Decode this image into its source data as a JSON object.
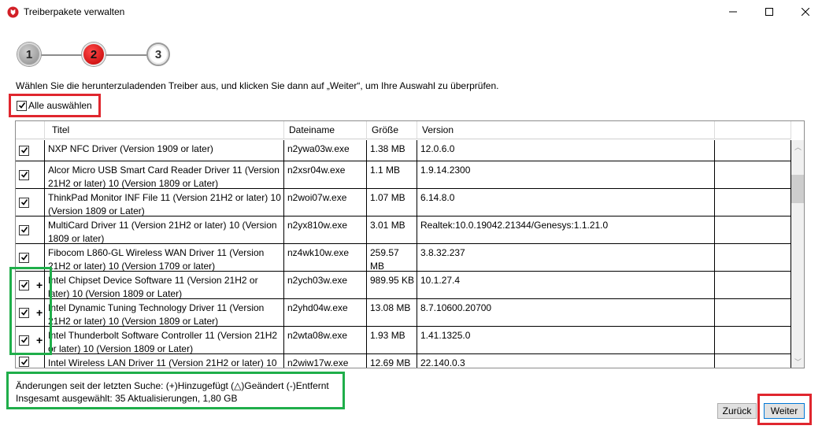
{
  "window": {
    "title": "Treiberpakete verwalten",
    "app_icon": "lenovo-shield-icon"
  },
  "stepper": {
    "steps": [
      "1",
      "2",
      "3"
    ],
    "current": 2
  },
  "instruction": "Wählen Sie die herunterzuladenden Treiber aus, und klicken Sie dann auf „Weiter“, um Ihre Auswahl zu überprüfen.",
  "select_all": {
    "label": "Alle auswählen",
    "checked": true
  },
  "table": {
    "columns": [
      "",
      "Titel",
      "Dateiname",
      "Größe",
      "Version",
      ""
    ],
    "rows": [
      {
        "checked": true,
        "mark": "",
        "title": "NXP NFC Driver (Version 1909 or later)",
        "file": "n2ywa03w.exe",
        "size": "1.38 MB",
        "version": "12.0.6.0"
      },
      {
        "checked": true,
        "mark": "",
        "title": "Alcor Micro USB Smart Card Reader Driver 11 (Version 21H2 or later) 10 (Version 1809 or Later)",
        "file": "n2xsr04w.exe",
        "size": "1.1 MB",
        "version": "1.9.14.2300"
      },
      {
        "checked": true,
        "mark": "",
        "title": "ThinkPad Monitor INF File 11 (Version 21H2 or later) 10 (Version 1809 or Later)",
        "file": "n2woi07w.exe",
        "size": "1.07 MB",
        "version": "6.14.8.0"
      },
      {
        "checked": true,
        "mark": "",
        "title": "MultiCard Driver 11 (Version 21H2 or later) 10 (Version 1809 or later)",
        "file": "n2yx810w.exe",
        "size": "3.01 MB",
        "version": "Realtek:10.0.19042.21344/Genesys:1.1.21.0"
      },
      {
        "checked": true,
        "mark": "",
        "title": "Fibocom L860-GL Wireless WAN Driver 11 (Version 21H2 or later) 10 (Version 1709 or later)",
        "file": "nz4wk10w.exe",
        "size": "259.57 MB",
        "version": "3.8.32.237"
      },
      {
        "checked": true,
        "mark": "+",
        "title": "Intel Chipset Device Software 11 (Version 21H2 or later) 10 (Version 1809 or Later)",
        "file": "n2ych03w.exe",
        "size": "989.95 KB",
        "version": "10.1.27.4"
      },
      {
        "checked": true,
        "mark": "+",
        "title": "Intel Dynamic Tuning Technology Driver 11 (Version 21H2 or later) 10 (Version 1809 or Later)",
        "file": "n2yhd04w.exe",
        "size": "13.08 MB",
        "version": "8.7.10600.20700"
      },
      {
        "checked": true,
        "mark": "+",
        "title": "Intel Thunderbolt Software Controller 11 (Version 21H2 or later) 10 (Version 1809 or Later)",
        "file": "n2wta08w.exe",
        "size": "1.93 MB",
        "version": "1.41.1325.0"
      },
      {
        "checked": true,
        "mark": "",
        "title": "Intel Wireless LAN Driver 11 (Version 21H2 or later) 10",
        "file": "n2wiw17w.exe",
        "size": "12.69 MB",
        "version": "22.140.0.3"
      }
    ]
  },
  "legend": {
    "line1": "Änderungen seit der letzten Suche: (+)Hinzugefügt  (△)Geändert  (-)Entfernt",
    "line2": "Insgesamt ausgewählt: 35 Aktualisierungen, 1,80 GB"
  },
  "buttons": {
    "back": "Zurück",
    "next": "Weiter"
  },
  "colors": {
    "highlight_red": "#e0262e",
    "highlight_green": "#1fae4a",
    "step_active": "#d40000"
  }
}
